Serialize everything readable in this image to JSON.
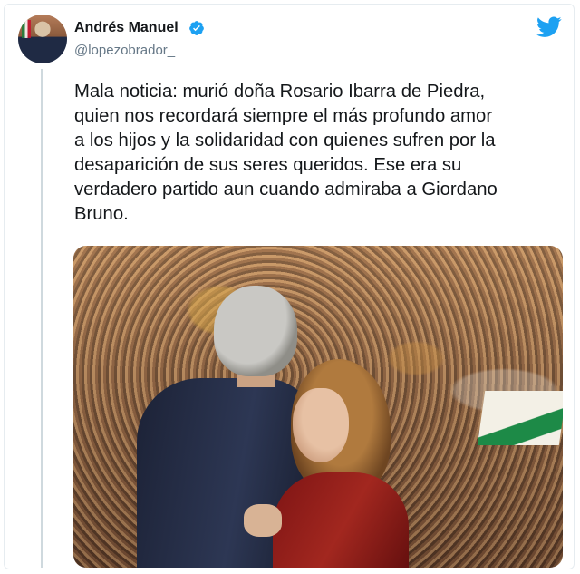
{
  "tweet": {
    "author_name": "Andrés Manuel",
    "author_handle": "@lopezobrador_",
    "verified": true,
    "text": "Mala noticia: murió doña Rosario Ibarra de Piedra,\nquien nos recordará siempre el más profundo amor\na los hijos y la solidaridad con quienes sufren por la\ndesaparición de sus seres queridos. Ese era su\nverdadero partido aun cuando admiraba a Giordano\nBruno."
  },
  "icons": {
    "verified": "verified-badge-icon",
    "brand": "twitter-bird-icon"
  },
  "colors": {
    "brand": "#1da1f2",
    "text": "#14171a",
    "secondary_text": "#657786",
    "thread_line": "#cfd9de"
  }
}
